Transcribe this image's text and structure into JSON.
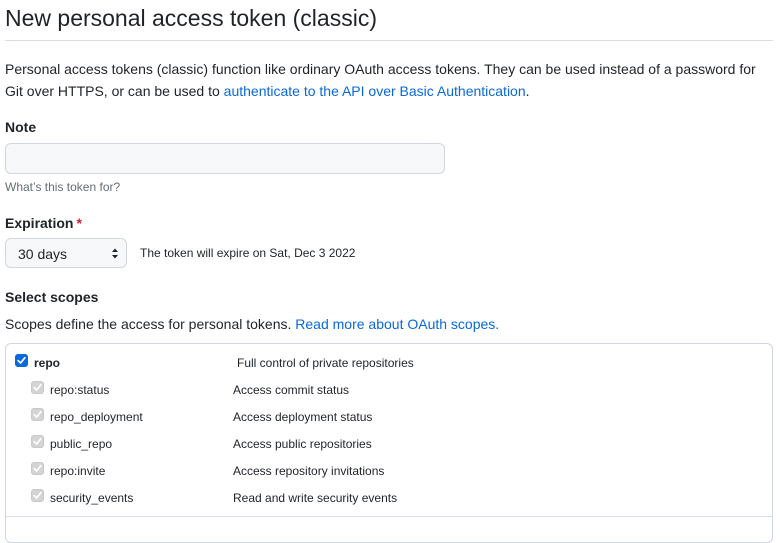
{
  "page_title": "New personal access token (classic)",
  "intro": {
    "text": "Personal access tokens (classic) function like ordinary OAuth access tokens. They can be used instead of a password for Git over HTTPS, or can be used to ",
    "link": "authenticate to the API over Basic Authentication",
    "suffix": "."
  },
  "note": {
    "label": "Note",
    "value": "",
    "placeholder": "",
    "hint": "What’s this token for?"
  },
  "expiration": {
    "label": "Expiration",
    "required_mark": "*",
    "selected": "30 days",
    "message": "The token will expire on Sat, Dec 3 2022"
  },
  "scopes": {
    "heading": "Select scopes",
    "description": "Scopes define the access for personal tokens. ",
    "link": "Read more about OAuth scopes.",
    "parent": {
      "name": "repo",
      "description": "Full control of private repositories",
      "checked": true
    },
    "children": [
      {
        "name": "repo:status",
        "description": "Access commit status",
        "checked": true,
        "disabled": true
      },
      {
        "name": "repo_deployment",
        "description": "Access deployment status",
        "checked": true,
        "disabled": true
      },
      {
        "name": "public_repo",
        "description": "Access public repositories",
        "checked": true,
        "disabled": true
      },
      {
        "name": "repo:invite",
        "description": "Access repository invitations",
        "checked": true,
        "disabled": true
      },
      {
        "name": "security_events",
        "description": "Read and write security events",
        "checked": true,
        "disabled": true
      }
    ]
  },
  "colors": {
    "link": "#0969da",
    "required": "#cf222e",
    "checkbox_checked": "#0969da",
    "checkbox_disabled": "#d4d4d4"
  }
}
